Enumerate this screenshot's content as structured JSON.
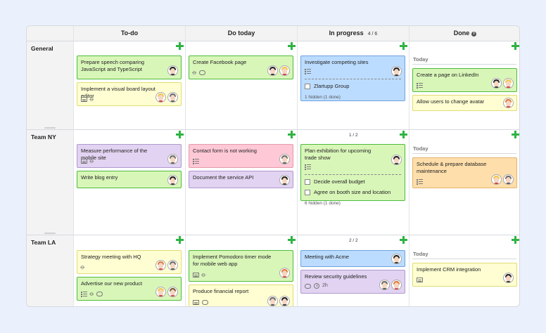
{
  "columns": [
    {
      "title": "To-do",
      "count": ""
    },
    {
      "title": "Do today",
      "count": ""
    },
    {
      "title": "In progress",
      "count": "4 / 6"
    },
    {
      "title": "Done",
      "count": ""
    }
  ],
  "lanes": [
    {
      "title": "General"
    },
    {
      "title": "Team NY"
    },
    {
      "title": "Team LA"
    }
  ],
  "cell_counts": {
    "ny_inprogress": "1 / 2",
    "la_inprogress": "2 / 2"
  },
  "today_label": "Today",
  "cards": {
    "g_todo_1": "Prepare speech comparing JavaScript and TypeScript",
    "g_todo_2": "Implement a visual board layout editor",
    "g_today_1": "Create Facebook page",
    "g_prog_1": "Investigate competing sites",
    "g_prog_1_sub": "Zlartupp Group",
    "g_prog_1_hidden": "1 hidden (1 done)",
    "g_done_1": "Create a page on LinkedIn",
    "g_done_2": "Allow users to change avatar",
    "ny_todo_1": "Measure performance of the mobile site",
    "ny_todo_2": "Write blog entry",
    "ny_today_1": "Contact form is not working",
    "ny_today_2": "Document the service API",
    "ny_prog_1": "Plan exhibition for upcoming trade show",
    "ny_prog_1_sub1": "Decide overall budget",
    "ny_prog_1_sub2": "Agree on booth size and location",
    "ny_prog_1_hidden": "6 hidden (1 done)",
    "ny_done_1": "Schedule & prepare database maintenance",
    "la_todo_1": "Strategy meeting with HQ",
    "la_todo_2": "Advertise our new product",
    "la_today_1": "Implement Pomodoro timer mode for mobile web app",
    "la_today_2": "Produce financial report",
    "la_prog_1": "Meeting with Acme",
    "la_prog_2": "Review security guidelines",
    "la_prog_2_time": "2h",
    "la_done_1": "Implement CRM integration"
  }
}
